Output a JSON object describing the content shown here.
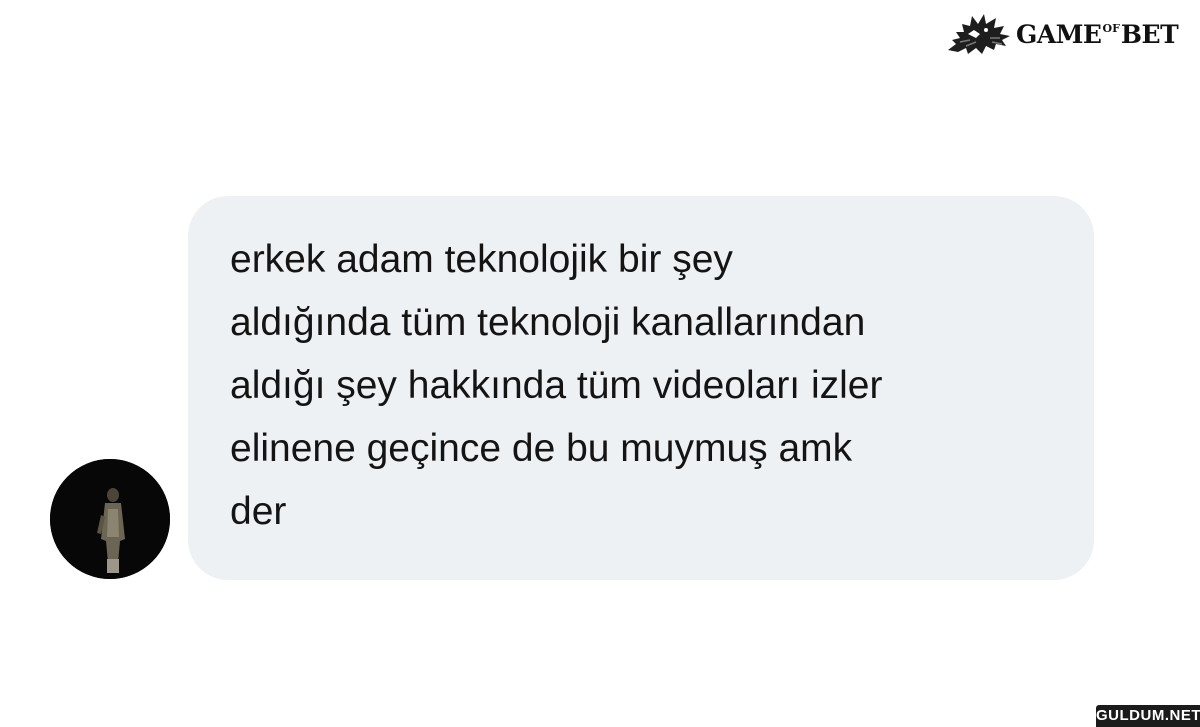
{
  "watermark": {
    "brand": "GAME",
    "brand_sup": "OF",
    "brand_end": "BET",
    "site": "GULDUM.NET"
  },
  "message": {
    "text": "erkek adam teknolojik bir şey\naldığında tüm teknoloji kanallarından\naldığı şey hakkında tüm videoları izler\nelinene geçince de bu muymuş amk\nder"
  },
  "colors": {
    "bubble_bg": "#eef1f4",
    "text": "#141414",
    "avatar_bg": "#070707"
  }
}
